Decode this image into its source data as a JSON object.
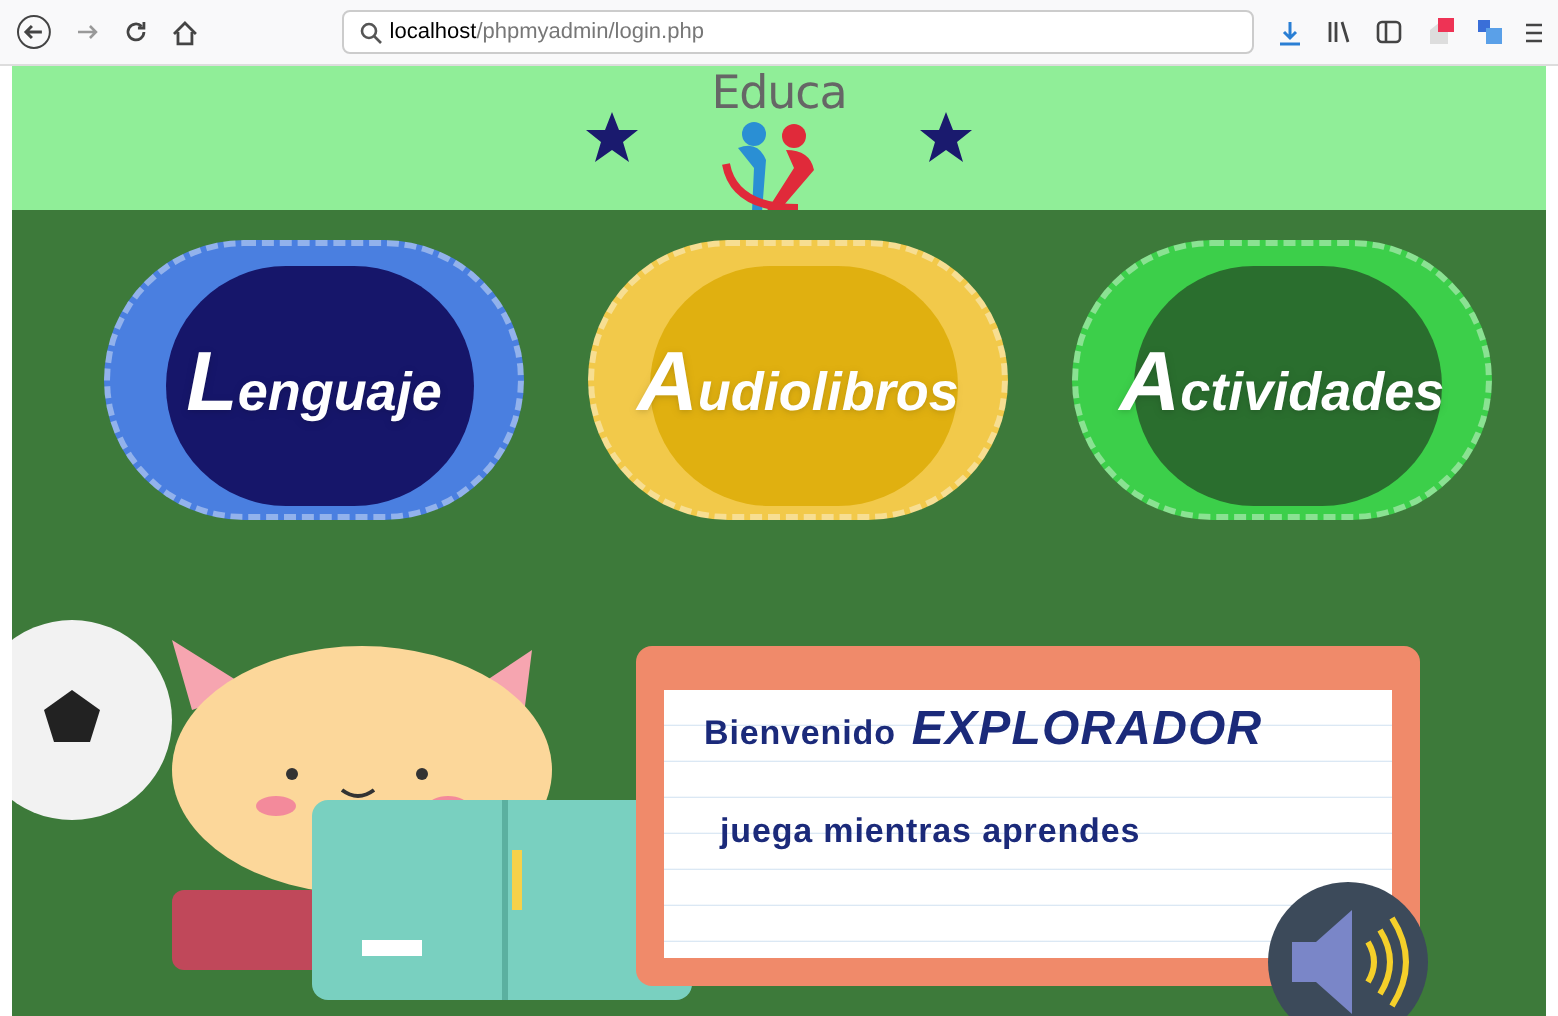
{
  "browser": {
    "url_host": "localhost",
    "url_path": "/phpmyadmin/login.php"
  },
  "header": {
    "title": "Educa"
  },
  "menu": [
    {
      "label": "Lenguaje",
      "kind": "blue"
    },
    {
      "label": "Audiolibros",
      "kind": "yellow"
    },
    {
      "label": "Actividades",
      "kind": "green"
    }
  ],
  "welcome": {
    "greeting": "Bienvenido",
    "name": "EXPLORADOR",
    "subtitle": "juega mientras aprendes"
  }
}
